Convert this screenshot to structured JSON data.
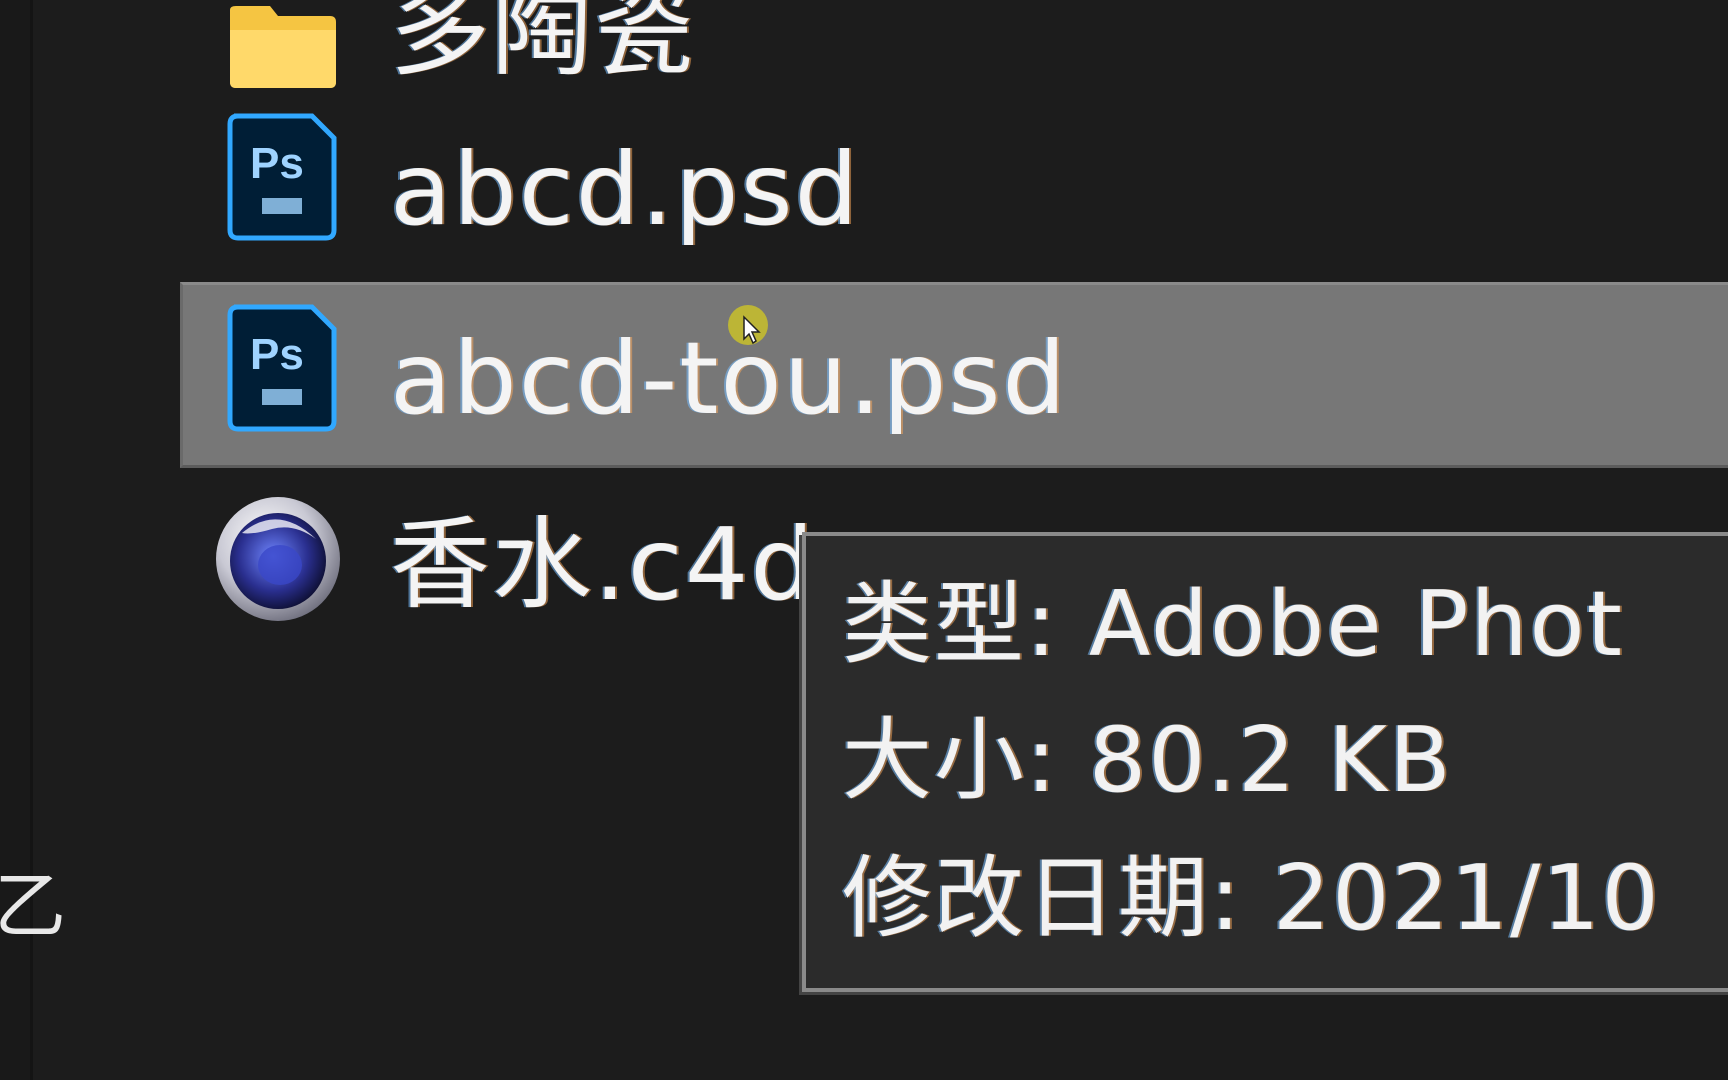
{
  "nav_pane": {
    "partial_text": "乙"
  },
  "file_list": {
    "items": [
      {
        "name": "多陶瓷",
        "icon": "folder-icon",
        "selected": false
      },
      {
        "name": "abcd.psd",
        "icon": "photoshop-file-icon",
        "selected": false
      },
      {
        "name": "abcd-tou.psd",
        "icon": "photoshop-file-icon",
        "selected": true
      },
      {
        "name": "香水.c4d",
        "icon": "cinema4d-file-icon",
        "selected": false
      }
    ]
  },
  "tooltip": {
    "type_line": "类型: Adobe Phot",
    "size_line": "大小: 80.2 KB",
    "modified_line": "修改日期: 2021/10"
  },
  "colors": {
    "background": "#1c1c1c",
    "selection": "#777777",
    "folder": "#f5c542",
    "photoshop_bg": "#001e36",
    "photoshop_accent": "#31a8ff",
    "cursor_highlight": "#c8c02a"
  }
}
